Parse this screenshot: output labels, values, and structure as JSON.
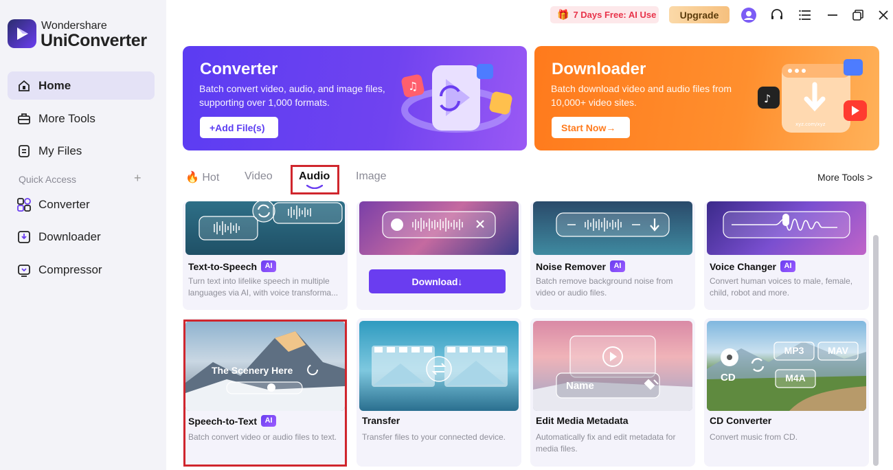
{
  "app": {
    "brand_top": "Wondershare",
    "brand_name": "UniConverter"
  },
  "sidebar": {
    "items": [
      {
        "label": "Home",
        "icon": "home-icon"
      },
      {
        "label": "More Tools",
        "icon": "toolbox-icon"
      },
      {
        "label": "My Files",
        "icon": "file-icon"
      }
    ],
    "quick_access_label": "Quick Access",
    "quick_access_add": "+",
    "quick_items": [
      {
        "label": "Converter",
        "icon": "converter-icon"
      },
      {
        "label": "Downloader",
        "icon": "downloader-icon"
      },
      {
        "label": "Compressor",
        "icon": "compressor-icon"
      }
    ]
  },
  "topbar": {
    "promo": "7 Days Free: AI Use",
    "upgrade": "Upgrade"
  },
  "banners": {
    "converter": {
      "title": "Converter",
      "desc": "Batch convert video, audio, and image files, supporting over 1,000 formats.",
      "button": "+Add File(s)"
    },
    "downloader": {
      "title": "Downloader",
      "desc": "Batch download video and audio files from 10,000+ video sites.",
      "button": "Start Now→",
      "art_url": "xyz.com/xyz"
    }
  },
  "tabs": [
    {
      "label": "Hot"
    },
    {
      "label": "Video"
    },
    {
      "label": "Audio"
    },
    {
      "label": "Image"
    }
  ],
  "more_tools": "More Tools >",
  "cards": {
    "tts": {
      "title": "Text-to-Speech",
      "ai": "AI",
      "desc": "Turn text into lifelike speech in multiple languages via AI, with voice transforma..."
    },
    "vocal": {
      "button": "Download↓"
    },
    "noise": {
      "title": "Noise Remover",
      "ai": "AI",
      "desc": "Batch remove background noise from video or audio files."
    },
    "voice": {
      "title": "Voice Changer",
      "ai": "AI",
      "desc": "Convert human voices to male, female, child, robot and more."
    },
    "stt": {
      "title": "Speech-to-Text",
      "ai": "AI",
      "desc": "Batch convert video or audio files to text.",
      "thumb_text": "The Scenery Here"
    },
    "transfer": {
      "title": "Transfer",
      "desc": "Transfer files to your connected device."
    },
    "metadata": {
      "title": "Edit Media Metadata",
      "desc": "Automatically fix and edit metadata for media files.",
      "thumb_text": "Name"
    },
    "cd": {
      "title": "CD Converter",
      "desc": "Convert music from CD.",
      "formats": [
        "MP3",
        "MAV",
        "M4A"
      ],
      "cd_label": "CD"
    }
  }
}
